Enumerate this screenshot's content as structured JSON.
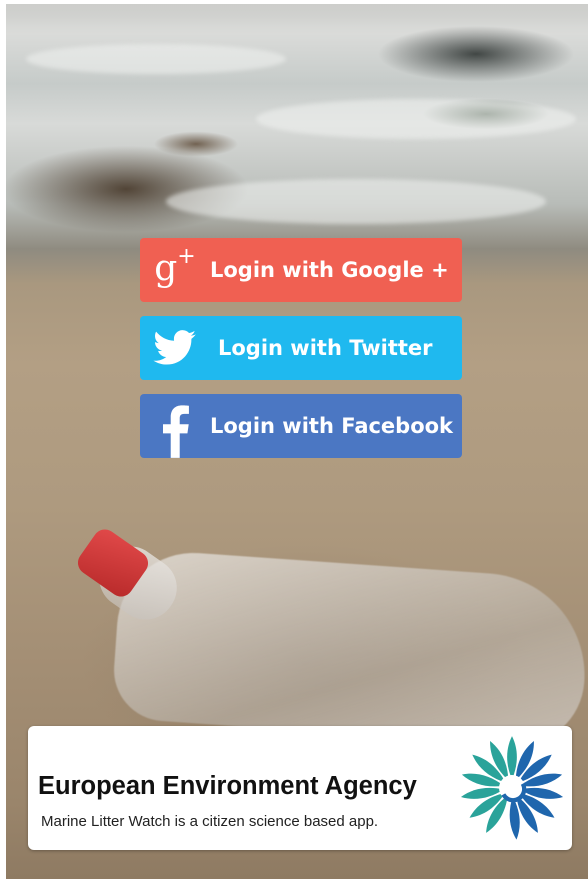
{
  "login": {
    "google_label": "Login with Google +",
    "google_icon_text": "g",
    "google_icon_plus": "+",
    "twitter_label": "Login with Twitter",
    "facebook_label": "Login with Facebook",
    "colors": {
      "google": "#f06052",
      "twitter": "#1fb9ef",
      "facebook": "#4b77c3"
    },
    "icons": {
      "google": "google-plus-icon",
      "twitter": "twitter-bird-icon",
      "facebook": "facebook-f-icon"
    }
  },
  "footer": {
    "agency_name": "European Environment Agency",
    "tagline": "Marine Litter Watch is a citizen science based app.",
    "logo_icon": "eea-logo-icon",
    "logo_colors": [
      "#2aa39a",
      "#1f66ad"
    ]
  }
}
